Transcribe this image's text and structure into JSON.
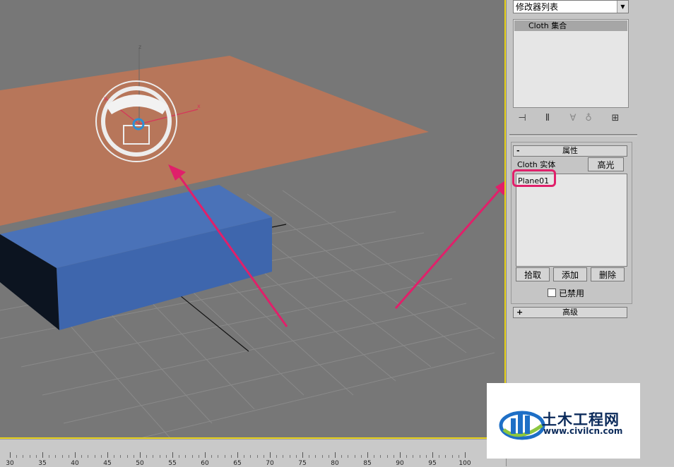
{
  "modifier_list": {
    "label": "修改器列表"
  },
  "modifier_stack": {
    "items": [
      "Cloth 集合"
    ]
  },
  "properties_rollout": {
    "title": "属性",
    "collapse_sign": "-",
    "cloth_object_label": "Cloth 实体",
    "highlight_button": "高光",
    "objects": [
      "Plane01"
    ],
    "pick_button": "拾取",
    "add_button": "添加",
    "delete_button": "删除",
    "disabled_checkbox": {
      "label": "已禁用",
      "checked": false
    }
  },
  "advanced_rollout": {
    "title": "高级",
    "expand_sign": "+"
  },
  "viewport": {
    "axis_labels": {
      "x": "x",
      "y": "y",
      "z": "z"
    }
  },
  "timeline_ruler": {
    "labels": [
      "30",
      "35",
      "40",
      "45",
      "50",
      "55",
      "60",
      "65",
      "70",
      "75",
      "80",
      "85",
      "90",
      "95",
      "100"
    ]
  },
  "watermark": {
    "name": "土木工程网",
    "url": "www.civilcn.com"
  },
  "colors": {
    "viewport_bg": "#777777",
    "plane": "#b7765a",
    "box_top": "#4a72b8",
    "box_front": "#3e66ad",
    "box_side": "#0c1420",
    "annotation": "#e0206a",
    "active_border": "#e8d21a"
  }
}
